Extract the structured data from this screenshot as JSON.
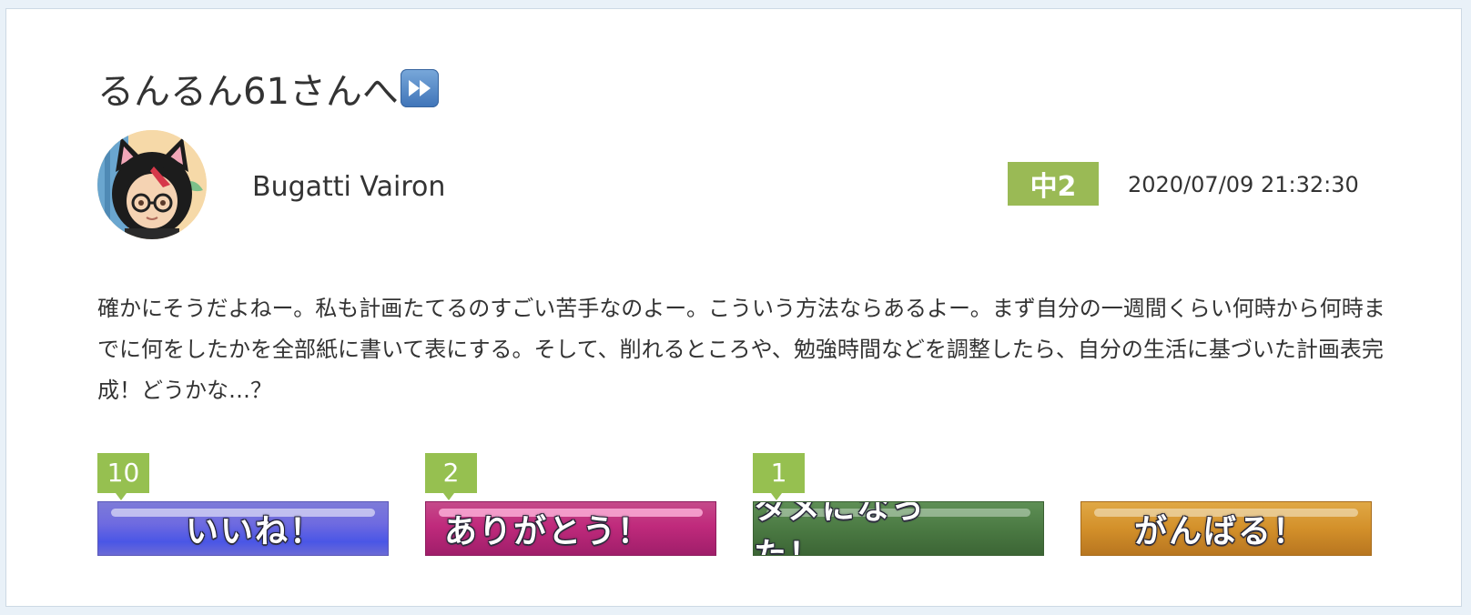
{
  "post": {
    "title": "るんるん61さんへ",
    "title_icon": "fast-forward-icon",
    "author": "Bugatti Vairon",
    "grade": "中2",
    "timestamp": "2020/07/09 21:32:30",
    "body": "確かにそうだよねー。私も計画たてるのすごい苦手なのよー。こういう方法ならあるよー。まず自分の一週間くらい何時から何時までに何をしたかを全部紙に書いて表にする。そして、削れるところや、勉強時間などを調整したら、自分の生活に基づいた計画表完成！どうかな…？"
  },
  "reactions": [
    {
      "label": "いいね！",
      "count": "10",
      "color": "#6f6be0"
    },
    {
      "label": "ありがとう！",
      "count": "2",
      "color": "#c02a7c"
    },
    {
      "label": "タメになった！",
      "count": "1",
      "color": "#4b7a43"
    },
    {
      "label": "がんばる！",
      "count": "",
      "color": "#d3902a"
    }
  ],
  "colors": {
    "grade_badge": "#9aba55",
    "count_badge": "#96c050",
    "page_background": "#e9f1f8"
  }
}
